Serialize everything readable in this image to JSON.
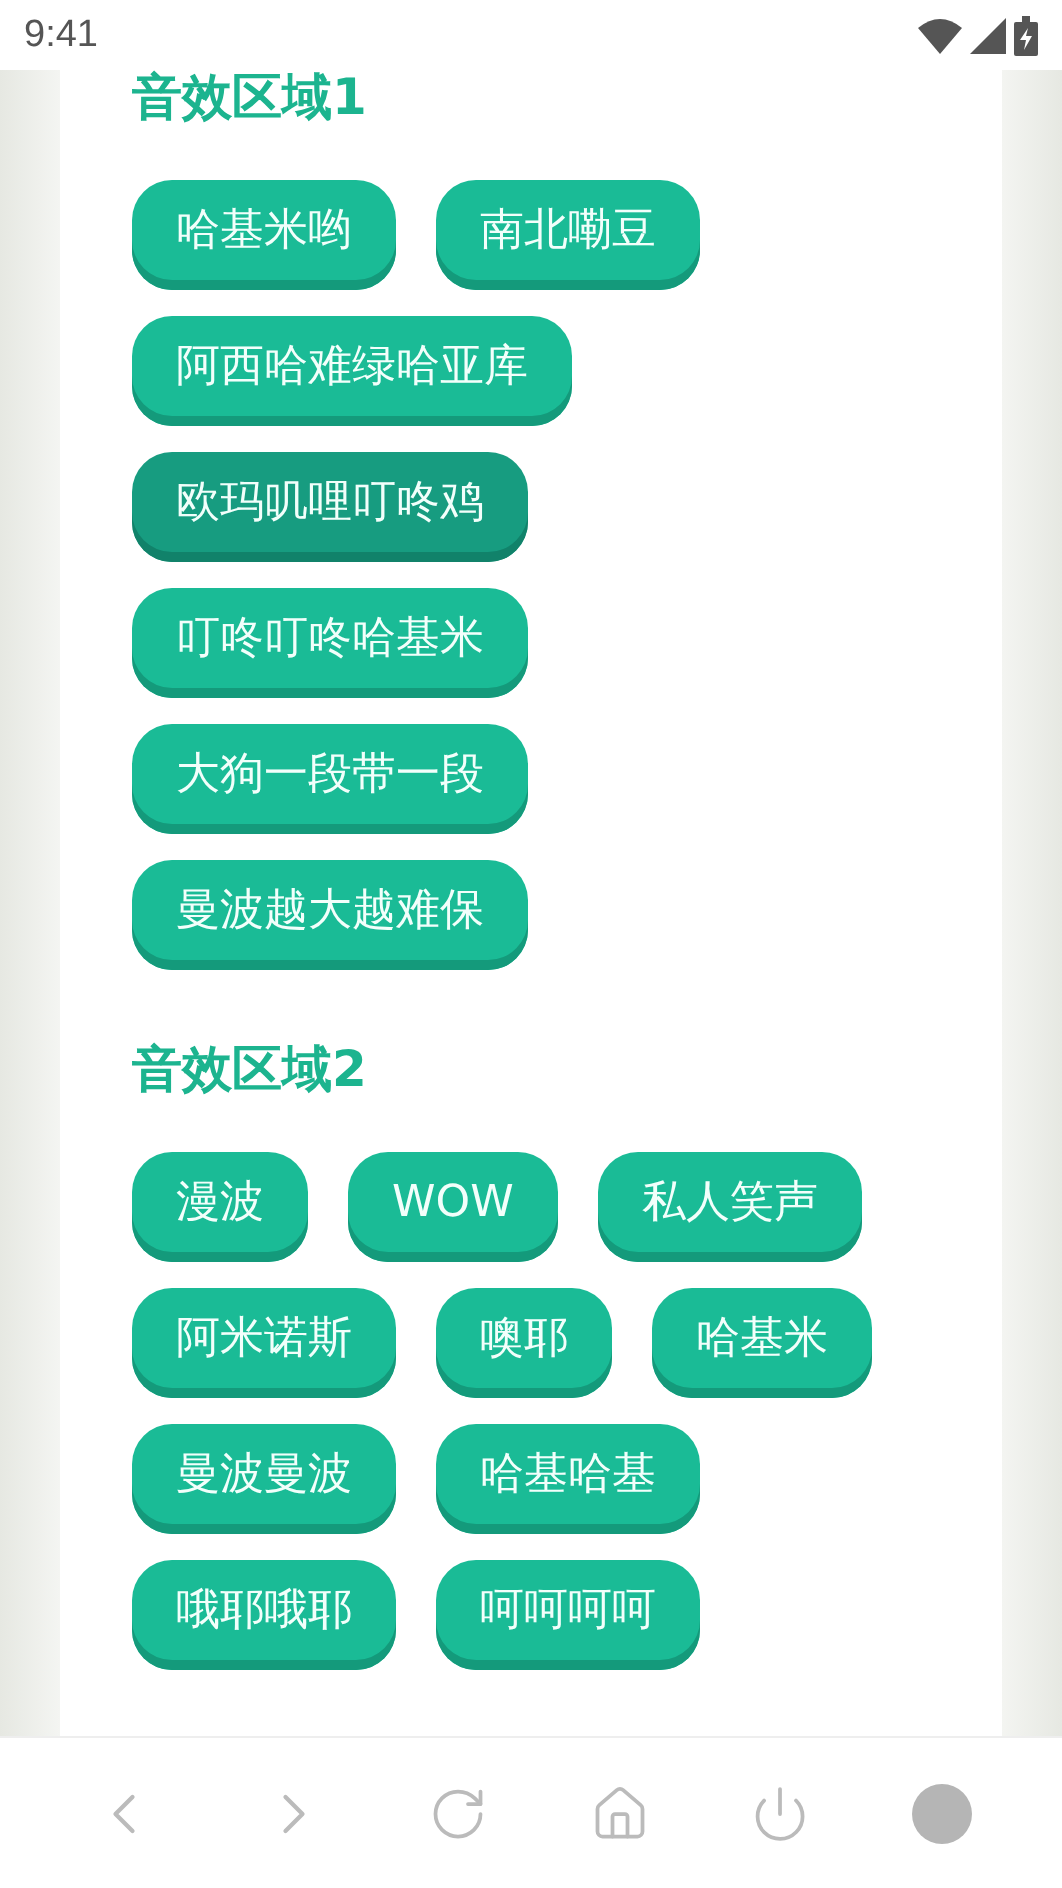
{
  "status_bar": {
    "time": "9:41"
  },
  "sections": [
    {
      "title": "音效区域1",
      "buttons": [
        {
          "label": "哈基米哟",
          "selected": false
        },
        {
          "label": "南北嘞豆",
          "selected": false
        },
        {
          "label": "阿西哈难绿哈亚库",
          "selected": false
        },
        {
          "label": "欧玛叽哩叮咚鸡",
          "selected": true
        },
        {
          "label": "叮咚叮咚哈基米",
          "selected": false
        },
        {
          "label": "大狗一段带一段",
          "selected": false
        },
        {
          "label": "曼波越大越难保",
          "selected": false
        }
      ]
    },
    {
      "title": "音效区域2",
      "buttons": [
        {
          "label": "漫波",
          "selected": false
        },
        {
          "label": "WOW",
          "selected": false
        },
        {
          "label": "私人笑声",
          "selected": false
        },
        {
          "label": "阿米诺斯",
          "selected": false
        },
        {
          "label": "噢耶",
          "selected": false
        },
        {
          "label": "哈基米",
          "selected": false
        },
        {
          "label": "曼波曼波",
          "selected": false
        },
        {
          "label": "哈基哈基",
          "selected": false
        },
        {
          "label": "哦耶哦耶",
          "selected": false
        },
        {
          "label": "呵呵呵呵",
          "selected": false
        }
      ]
    }
  ]
}
